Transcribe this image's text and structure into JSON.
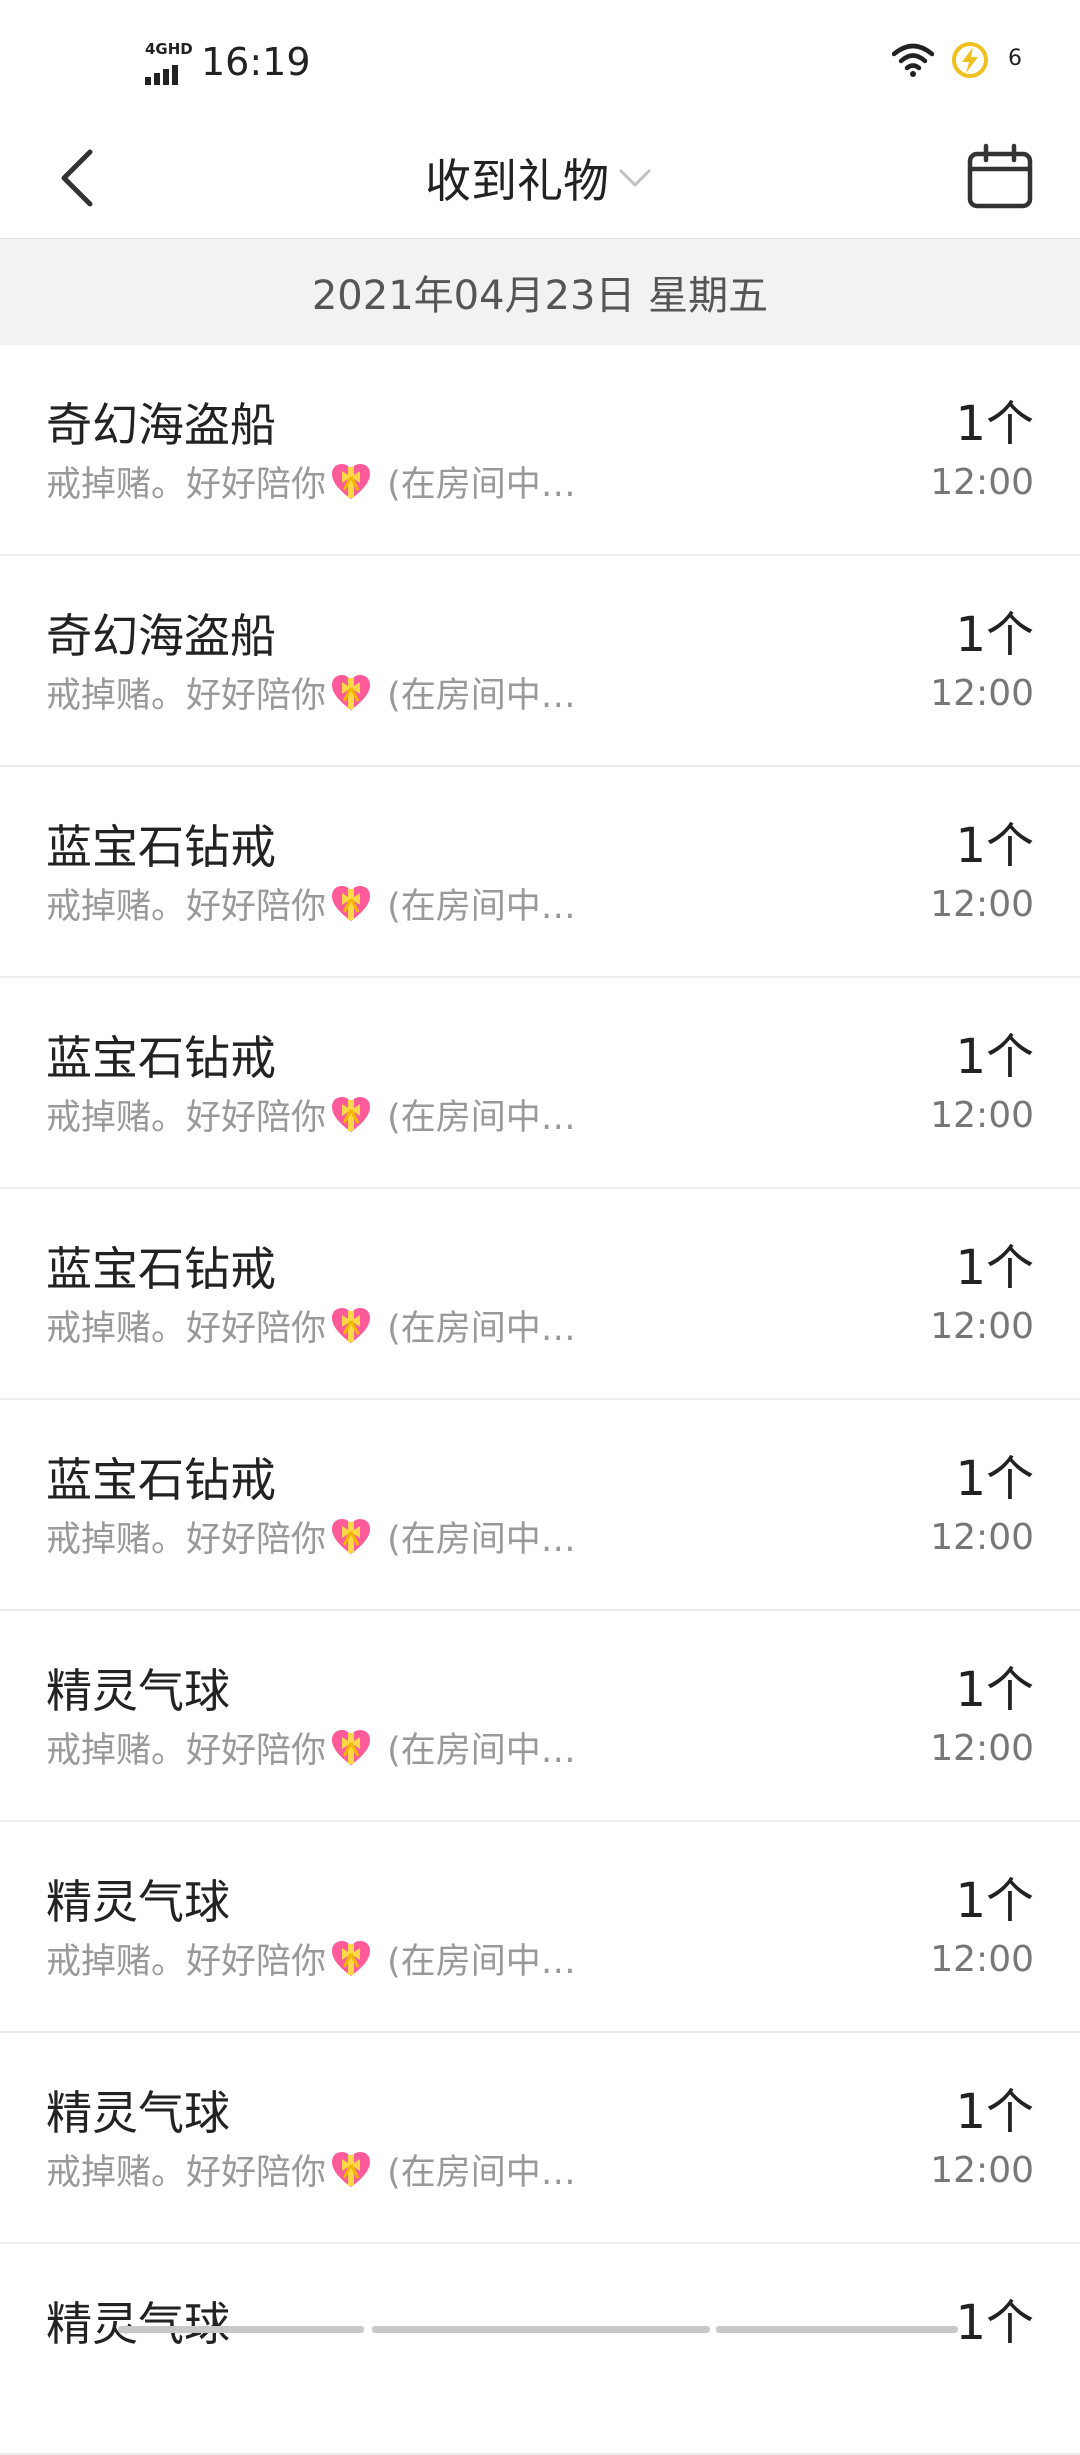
{
  "status": {
    "network": "4GHD",
    "time": "16:19",
    "battery": "6"
  },
  "nav": {
    "title": "收到礼物"
  },
  "date_header": "2021年04月23日 星期五",
  "items": [
    {
      "name": "奇幻海盗船",
      "message_before": "戒掉赌。好好陪你",
      "message_after": " (在房间中…",
      "count": "1个",
      "time": "12:00"
    },
    {
      "name": "奇幻海盗船",
      "message_before": "戒掉赌。好好陪你",
      "message_after": " (在房间中…",
      "count": "1个",
      "time": "12:00"
    },
    {
      "name": "蓝宝石钻戒",
      "message_before": "戒掉赌。好好陪你",
      "message_after": " (在房间中…",
      "count": "1个",
      "time": "12:00"
    },
    {
      "name": "蓝宝石钻戒",
      "message_before": "戒掉赌。好好陪你",
      "message_after": " (在房间中…",
      "count": "1个",
      "time": "12:00"
    },
    {
      "name": "蓝宝石钻戒",
      "message_before": "戒掉赌。好好陪你",
      "message_after": " (在房间中…",
      "count": "1个",
      "time": "12:00"
    },
    {
      "name": "蓝宝石钻戒",
      "message_before": "戒掉赌。好好陪你",
      "message_after": " (在房间中…",
      "count": "1个",
      "time": "12:00"
    },
    {
      "name": "精灵气球",
      "message_before": "戒掉赌。好好陪你",
      "message_after": " (在房间中…",
      "count": "1个",
      "time": "12:00"
    },
    {
      "name": "精灵气球",
      "message_before": "戒掉赌。好好陪你",
      "message_after": " (在房间中…",
      "count": "1个",
      "time": "12:00"
    },
    {
      "name": "精灵气球",
      "message_before": "戒掉赌。好好陪你",
      "message_after": " (在房间中…",
      "count": "1个",
      "time": "12:00"
    },
    {
      "name": "精灵气球",
      "message_before": "",
      "message_after": "",
      "count": "1个",
      "time": ""
    }
  ],
  "icons": {
    "back": "back-arrow-icon",
    "title_dropdown": "chevron-down-icon",
    "calendar": "calendar-icon",
    "message_emoji": "heart-with-ribbon-icon",
    "wifi": "wifi-icon",
    "charging": "charging-bolt-icon"
  },
  "colors": {
    "text_primary": "#222222",
    "text_secondary": "#999999",
    "date_header_bg": "#f2f2f2",
    "divider": "#ececec",
    "heart": "#ff5a9a",
    "ribbon": "#ffd84a"
  }
}
